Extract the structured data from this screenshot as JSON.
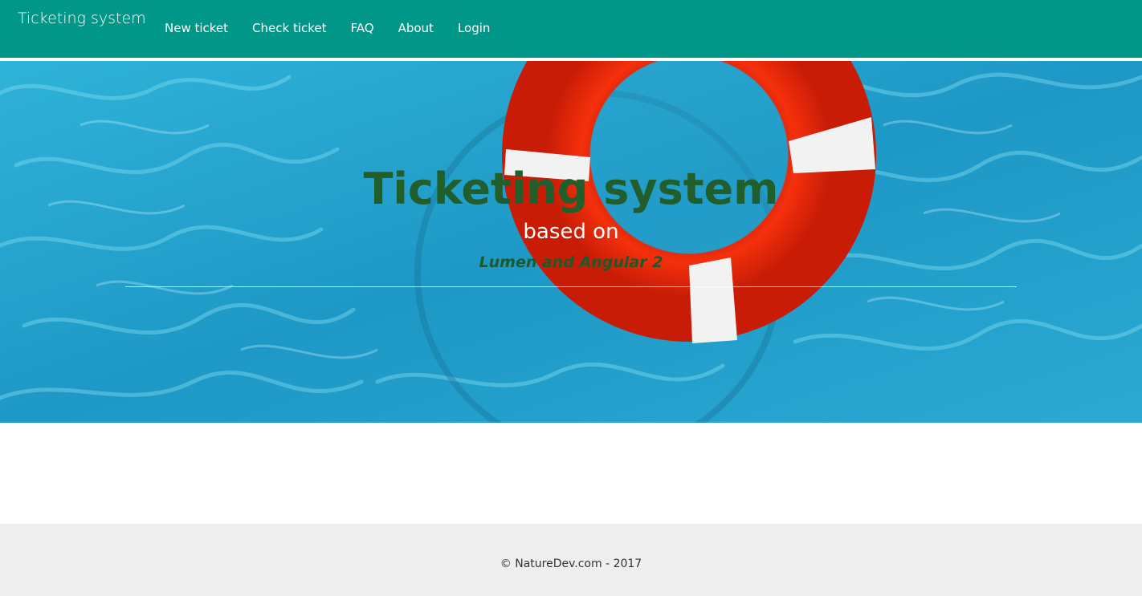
{
  "navbar": {
    "brand": "Ticketing system",
    "background_color": "#009688",
    "links": [
      {
        "label": "New ticket"
      },
      {
        "label": "Check ticket"
      },
      {
        "label": "FAQ"
      },
      {
        "label": "About"
      },
      {
        "label": "Login"
      }
    ]
  },
  "hero": {
    "title": "Ticketing system",
    "subtitle": "based on",
    "tech": "Lumen and Angular 2",
    "image": "lifebuoy-in-pool",
    "title_color": "#215e2c",
    "water_color": "#1fa0c8",
    "ring_color": "#f02a0a"
  },
  "footer": {
    "text": "© NatureDev.com - 2017"
  }
}
